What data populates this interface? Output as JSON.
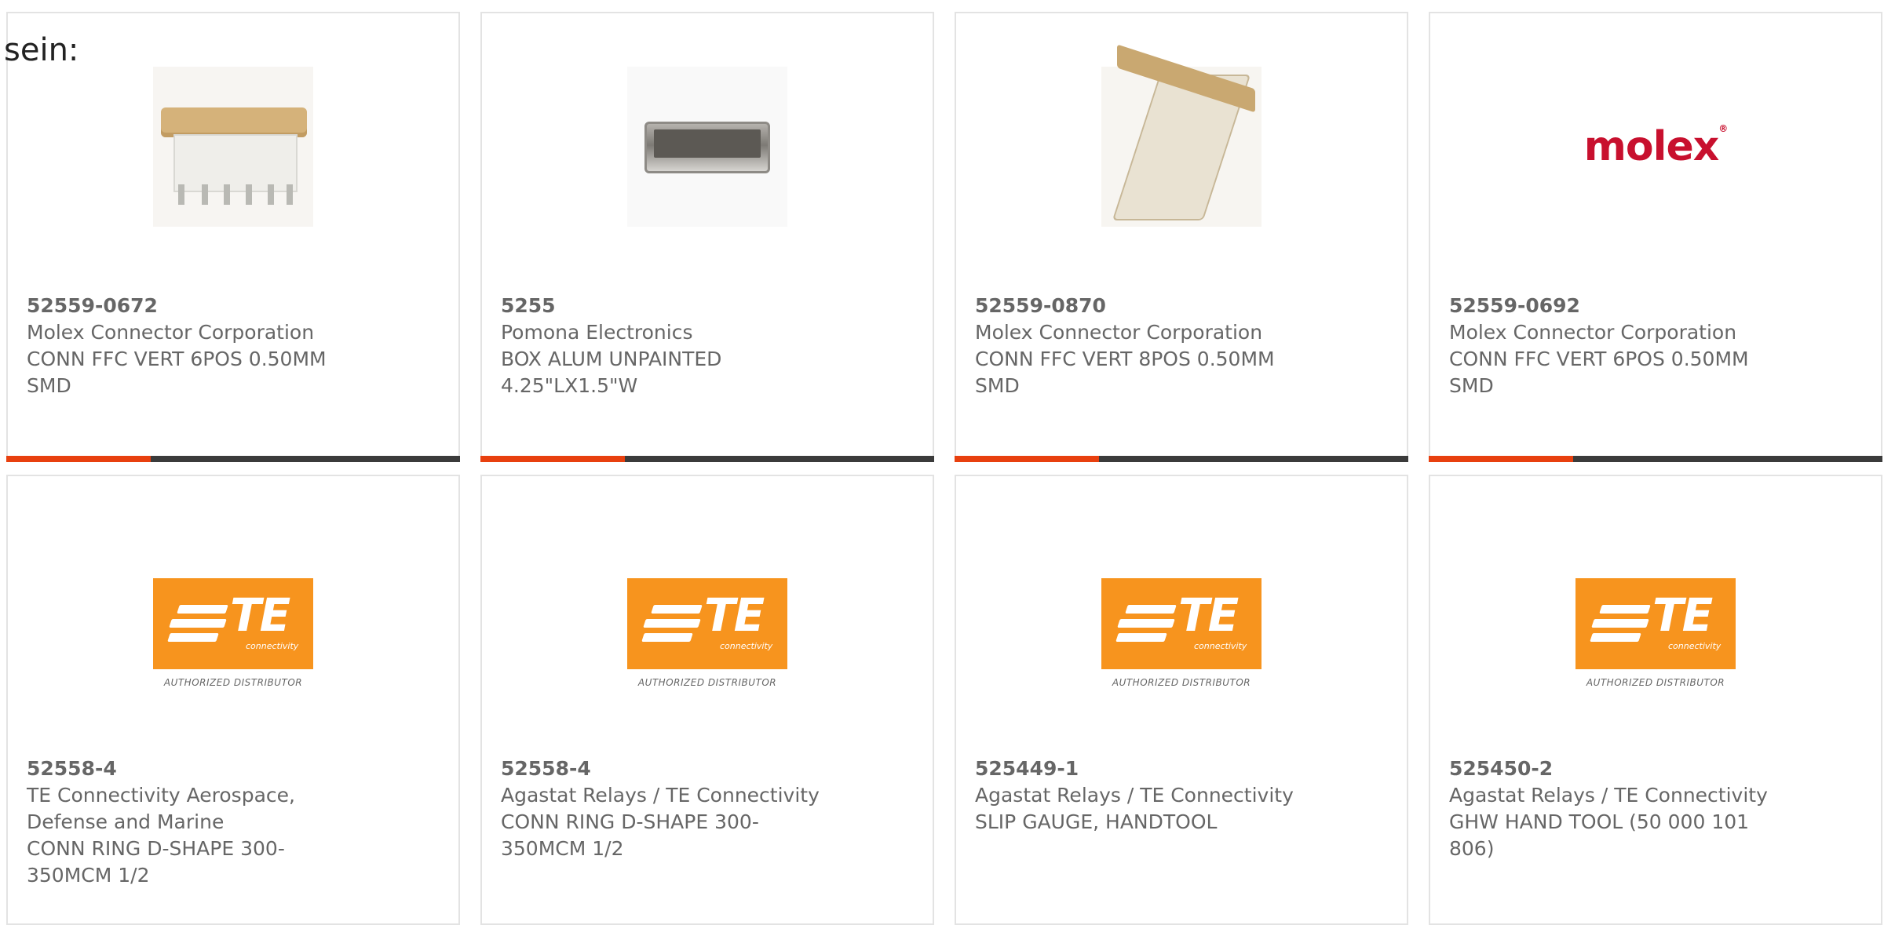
{
  "lead_text": "sein:",
  "accent_color": "#e8400f",
  "cards": [
    {
      "part_number": "52559-0672",
      "manufacturer": "Molex Connector Corporation",
      "description": "CONN FFC VERT 6POS 0.50MM SMD",
      "image": "ffc-connector-photo"
    },
    {
      "part_number": "5255",
      "manufacturer": "Pomona Electronics",
      "description": "BOX ALUM UNPAINTED 4.25\"LX1.5\"W",
      "image": "aluminum-box-photo"
    },
    {
      "part_number": "52559-0870",
      "manufacturer": "Molex Connector Corporation",
      "description": "CONN FFC VERT 8POS 0.50MM SMD",
      "image": "ffc-connector-vertical-photo"
    },
    {
      "part_number": "52559-0692",
      "manufacturer": "Molex Connector Corporation",
      "description": "CONN FFC VERT 6POS 0.50MM SMD",
      "image": "molex-logo",
      "logo_text": "molex"
    },
    {
      "part_number": "52558-4",
      "manufacturer": "TE Connectivity Aerospace, Defense and Marine",
      "description": "CONN RING D-SHAPE 300-350MCM 1/2",
      "image": "te-connectivity-logo"
    },
    {
      "part_number": "52558-4",
      "manufacturer": "Agastat Relays / TE Connectivity",
      "description": "CONN RING D-SHAPE 300-350MCM 1/2",
      "image": "te-connectivity-logo"
    },
    {
      "part_number": "525449-1",
      "manufacturer": "Agastat Relays / TE Connectivity",
      "description": "SLIP GAUGE, HANDTOOL",
      "image": "te-connectivity-logo"
    },
    {
      "part_number": "525450-2",
      "manufacturer": "Agastat Relays / TE Connectivity",
      "description": "GHW HAND TOOL (50 000 101 806)",
      "image": "te-connectivity-logo"
    }
  ],
  "te_logo": {
    "wordmark": "TE",
    "sub": "connectivity",
    "tagline": "AUTHORIZED DISTRIBUTOR"
  }
}
